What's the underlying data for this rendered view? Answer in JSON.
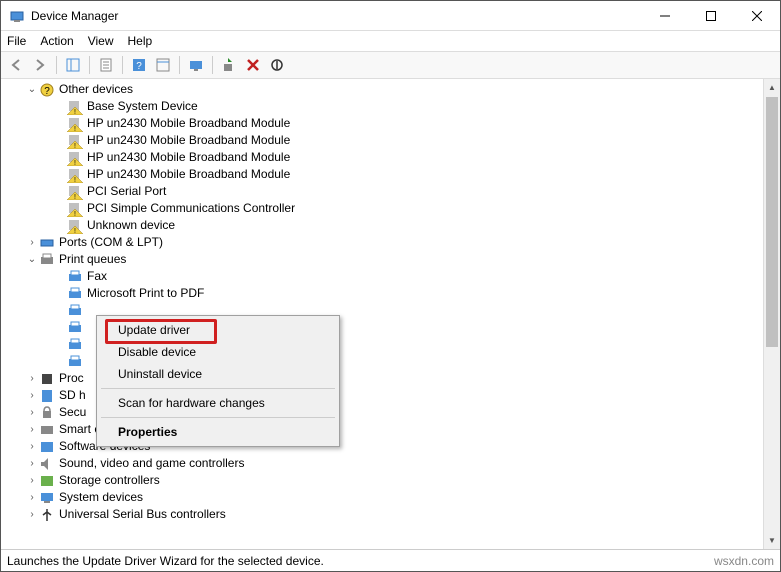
{
  "window": {
    "title": "Device Manager"
  },
  "menu": {
    "file": "File",
    "action": "Action",
    "view": "View",
    "help": "Help"
  },
  "tree": {
    "other": {
      "label": "Other devices",
      "items": [
        "Base System Device",
        "HP un2430 Mobile Broadband Module",
        "HP un2430 Mobile Broadband Module",
        "HP un2430 Mobile Broadband Module",
        "HP un2430 Mobile Broadband Module",
        "PCI Serial Port",
        "PCI Simple Communications Controller",
        "Unknown device"
      ]
    },
    "ports": {
      "label": "Ports (COM & LPT)"
    },
    "printq": {
      "label": "Print queues",
      "items": [
        "Fax",
        "Microsoft Print to PDF"
      ]
    },
    "proc": {
      "label": "Proc"
    },
    "sdh": {
      "label": "SD h"
    },
    "secu": {
      "label": "Secu"
    },
    "smart": {
      "label": "Smart card readers"
    },
    "soft": {
      "label": "Software devices"
    },
    "sound": {
      "label": "Sound, video and game controllers"
    },
    "storage": {
      "label": "Storage controllers"
    },
    "system": {
      "label": "System devices"
    },
    "usb": {
      "label": "Universal Serial Bus controllers"
    }
  },
  "context": {
    "update": "Update driver",
    "disable": "Disable device",
    "uninstall": "Uninstall device",
    "scan": "Scan for hardware changes",
    "properties": "Properties"
  },
  "status": {
    "text": "Launches the Update Driver Wizard for the selected device.",
    "watermark": "wsxdn.com"
  }
}
